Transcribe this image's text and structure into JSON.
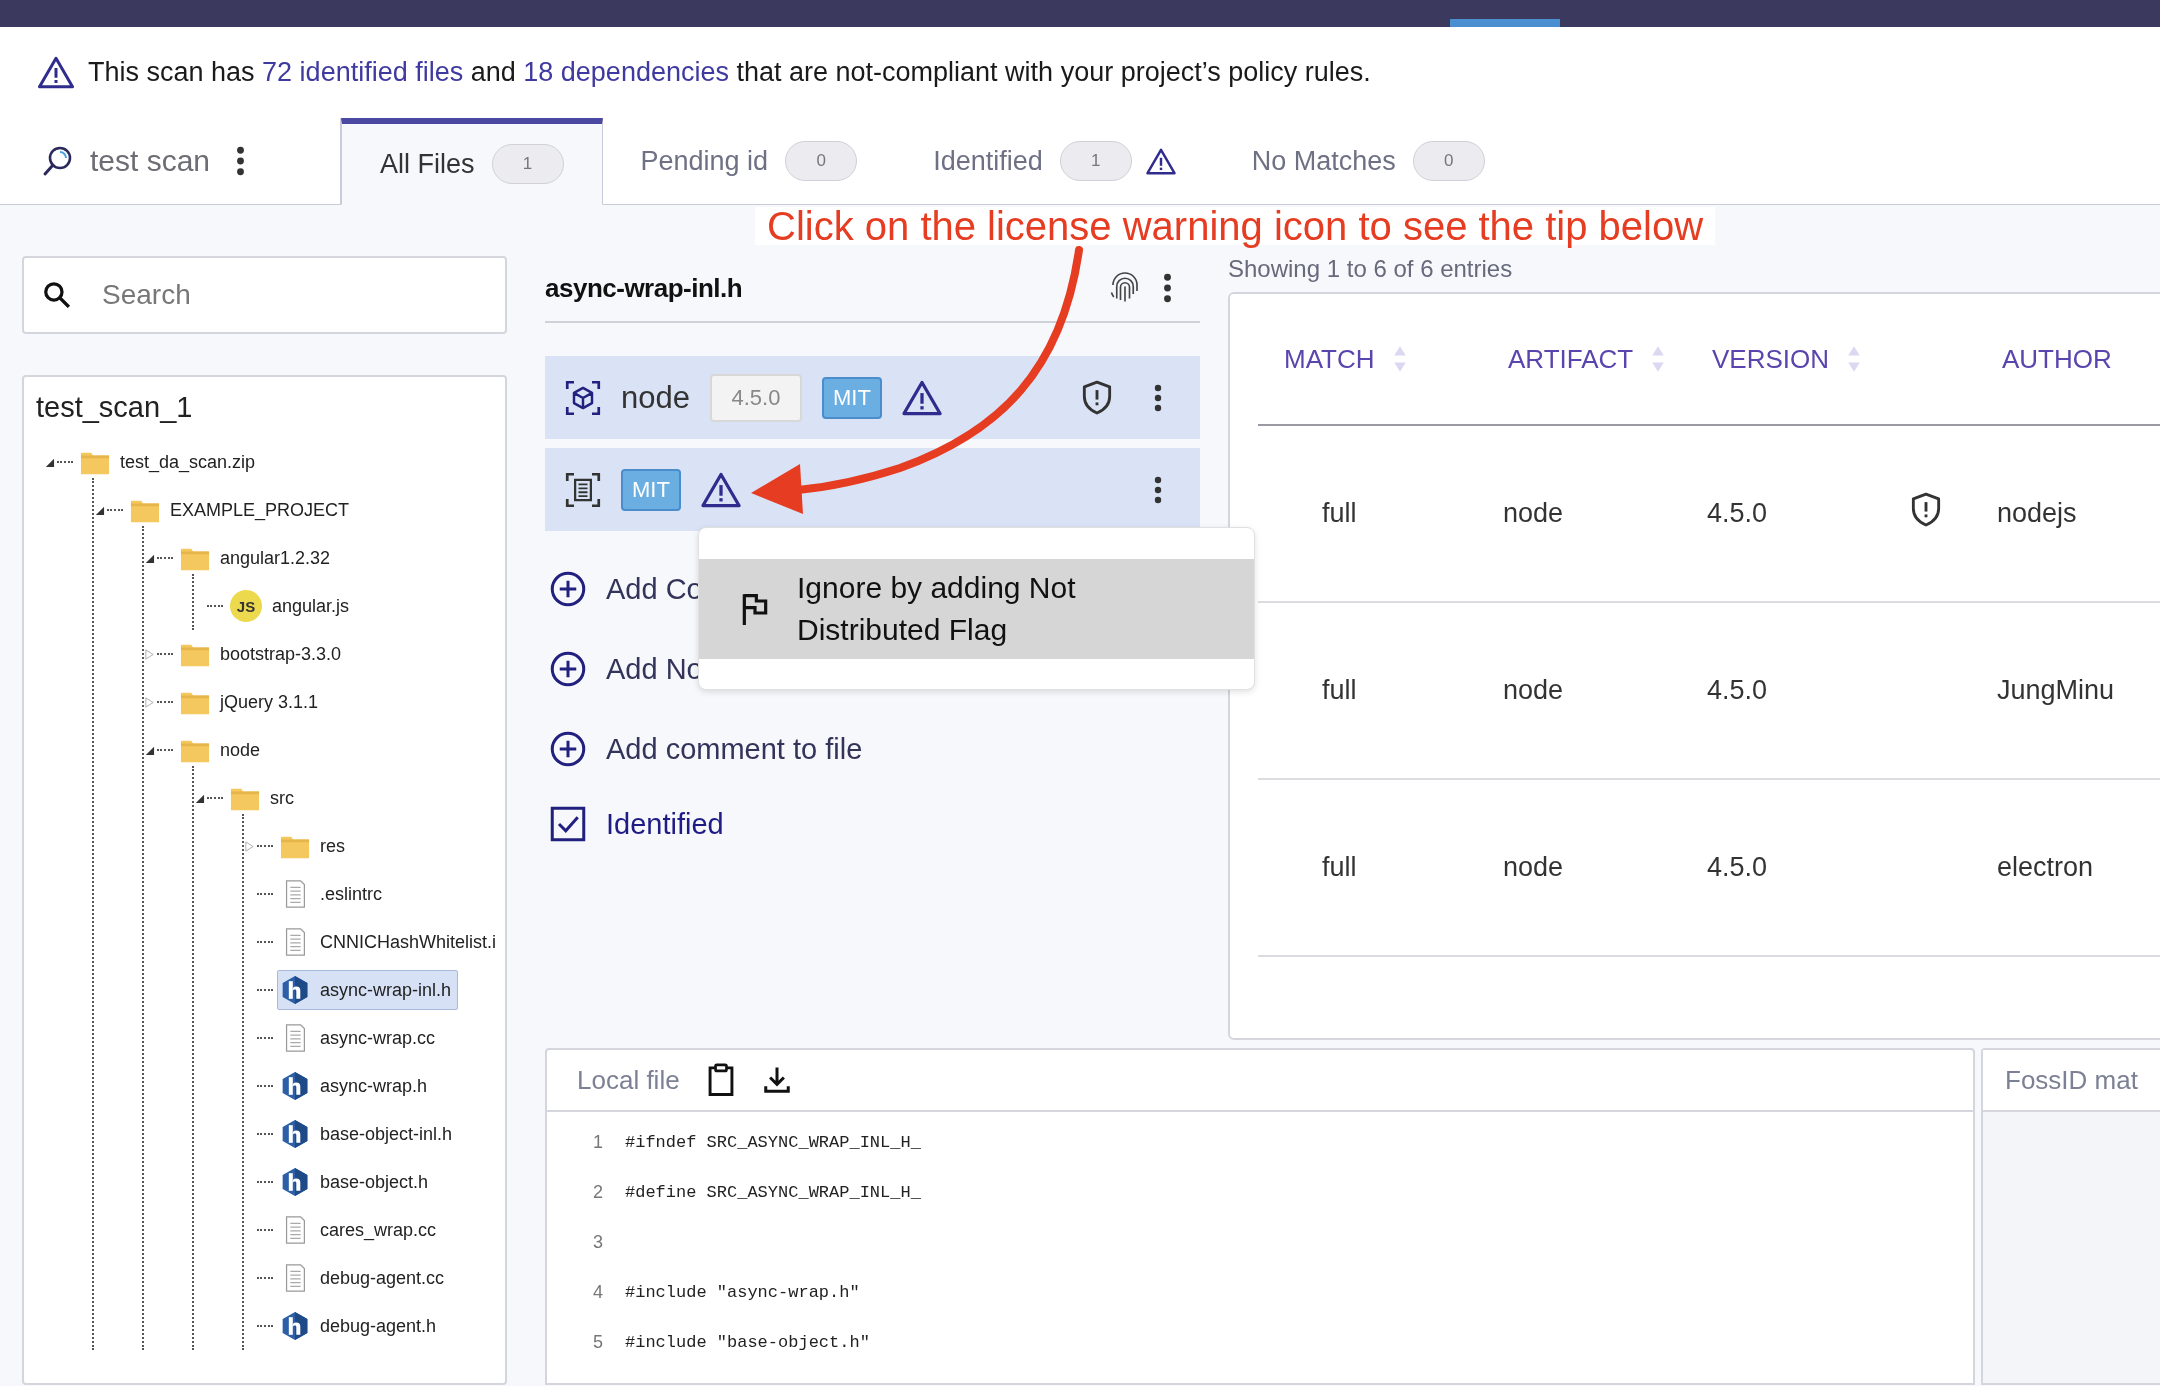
{
  "alert": {
    "segments": [
      {
        "kind": "text",
        "text": "This scan has "
      },
      {
        "kind": "link",
        "text": "72 identified files"
      },
      {
        "kind": "text",
        "text": " and "
      },
      {
        "kind": "link",
        "text": "18 dependencies"
      },
      {
        "kind": "text",
        "text": " that are not-compliant with your project’s policy rules."
      }
    ]
  },
  "scan": {
    "name": "test scan"
  },
  "tabs": [
    {
      "label": "All Files",
      "count": "1",
      "selected": true,
      "warning": false
    },
    {
      "label": "Pending id",
      "count": "0",
      "selected": false,
      "warning": false
    },
    {
      "label": "Identified",
      "count": "1",
      "selected": false,
      "warning": true
    },
    {
      "label": "No Matches",
      "count": "0",
      "selected": false,
      "warning": false
    }
  ],
  "annotation": {
    "text": "Click on the license warning icon to see the tip below"
  },
  "search": {
    "placeholder": "Search"
  },
  "tree": {
    "title": "test_scan_1",
    "items": [
      {
        "label": "test_da_scan.zip",
        "kind": "folder",
        "expanded": true,
        "selected": false,
        "children": [
          {
            "label": "EXAMPLE_PROJECT",
            "kind": "folder",
            "expanded": true,
            "selected": false,
            "children": [
              {
                "label": "angular1.2.32",
                "kind": "folder",
                "expanded": true,
                "selected": false,
                "children": [
                  {
                    "label": "angular.js",
                    "kind": "js",
                    "badge": "JS",
                    "selected": false
                  }
                ]
              },
              {
                "label": "bootstrap-3.3.0",
                "kind": "folder",
                "expanded": false,
                "selected": false
              },
              {
                "label": "jQuery 3.1.1",
                "kind": "folder",
                "expanded": false,
                "selected": false
              },
              {
                "label": "node",
                "kind": "folder",
                "expanded": true,
                "selected": false,
                "children": [
                  {
                    "label": "src",
                    "kind": "folder",
                    "expanded": true,
                    "selected": false,
                    "children": [
                      {
                        "label": "res",
                        "kind": "folder",
                        "expanded": false,
                        "selected": false
                      },
                      {
                        "label": ".eslintrc",
                        "kind": "file",
                        "selected": false
                      },
                      {
                        "label": "CNNICHashWhitelist.i",
                        "kind": "file",
                        "selected": false
                      },
                      {
                        "label": "async-wrap-inl.h",
                        "kind": "header",
                        "selected": true
                      },
                      {
                        "label": "async-wrap.cc",
                        "kind": "file",
                        "selected": false
                      },
                      {
                        "label": "async-wrap.h",
                        "kind": "header",
                        "selected": false
                      },
                      {
                        "label": "base-object-inl.h",
                        "kind": "header",
                        "selected": false
                      },
                      {
                        "label": "base-object.h",
                        "kind": "header",
                        "selected": false
                      },
                      {
                        "label": "cares_wrap.cc",
                        "kind": "file",
                        "selected": false
                      },
                      {
                        "label": "debug-agent.cc",
                        "kind": "file",
                        "selected": false
                      },
                      {
                        "label": "debug-agent.h",
                        "kind": "header",
                        "selected": false
                      }
                    ]
                  }
                ]
              }
            ]
          }
        ]
      }
    ]
  },
  "file_panel": {
    "title": "async-wrap-inl.h",
    "matches": [
      {
        "kind": "component",
        "name": "node",
        "version": "4.5.0",
        "license": "MIT",
        "license_warning": true,
        "vulnerable": true
      },
      {
        "kind": "file_license",
        "license": "MIT",
        "license_warning": true
      }
    ],
    "actions": [
      "Add Co",
      "Add No",
      "Add comment to file"
    ],
    "identified": {
      "label": "Identified",
      "checked": true
    }
  },
  "menu": {
    "items": [
      {
        "label": "Ignore by adding Not Distributed Flag",
        "highlighted": true
      }
    ]
  },
  "results": {
    "summary": "Showing 1 to 6 of 6 entries",
    "columns": [
      {
        "label": "MATCH",
        "sortable": true
      },
      {
        "label": "ARTIFACT",
        "sortable": true
      },
      {
        "label": "VERSION",
        "sortable": true
      },
      {
        "label": "AUTHOR",
        "sortable": false
      }
    ],
    "rows": [
      {
        "match": "full",
        "artifact": "node",
        "version": "4.5.0",
        "vulnerable": true,
        "author": "nodejs"
      },
      {
        "match": "full",
        "artifact": "node",
        "version": "4.5.0",
        "vulnerable": false,
        "author": "JungMinu"
      },
      {
        "match": "full",
        "artifact": "node",
        "version": "4.5.0",
        "vulnerable": false,
        "author": "electron"
      }
    ]
  },
  "local_file": {
    "title": "Local file",
    "lines": [
      {
        "number": "1",
        "code": "#ifndef SRC_ASYNC_WRAP_INL_H_"
      },
      {
        "number": "2",
        "code": "#define SRC_ASYNC_WRAP_INL_H_"
      },
      {
        "number": "3"
      },
      {
        "number": "4",
        "code": "#include \"async-wrap.h\""
      },
      {
        "number": "5",
        "code": "#include \"base-object.h\""
      }
    ]
  },
  "fossid": {
    "title": "FossID mat"
  }
}
